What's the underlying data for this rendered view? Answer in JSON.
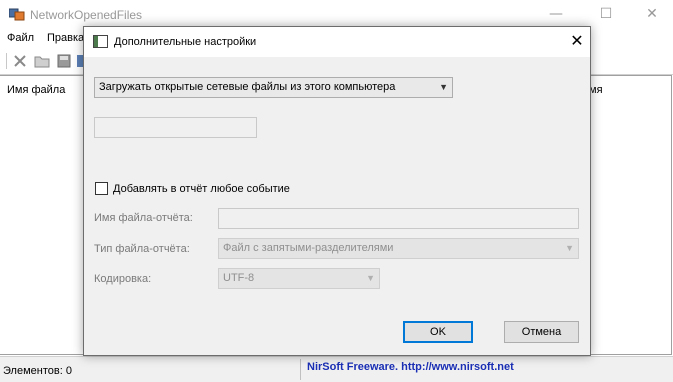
{
  "app": {
    "title": "NetworkOpenedFiles",
    "menu": [
      "Файл",
      "Правка"
    ],
    "toolbar_icons": [
      "delete-icon",
      "open-folder-icon",
      "save-icon",
      "copy-icon"
    ],
    "columns": [
      "Имя файла",
      "мя"
    ],
    "status_count": "Элементов: 0",
    "status_link": "NirSoft Freeware.  http://www.nirsoft.net"
  },
  "dialog": {
    "title": "Дополнительные настройки",
    "close_glyph": "✕",
    "source_select": "Загружать открытые сетевые файлы из этого компьютера",
    "remote_computer_value": "",
    "log_checkbox_label": "Добавлять в отчёт любое событие",
    "log_checked": false,
    "log_file_label": "Имя файла-отчёта:",
    "log_file_value": "",
    "log_type_label": "Тип файла-отчёта:",
    "log_type_value": "Файл с запятыми-разделителями",
    "encoding_label": "Кодировка:",
    "encoding_value": "UTF-8",
    "ok_label": "OK",
    "cancel_label": "Отмена"
  },
  "colors": {
    "link": "#1a2fb5",
    "default_button_border": "#0078d7",
    "dialog_background": "#f0f0f0"
  }
}
